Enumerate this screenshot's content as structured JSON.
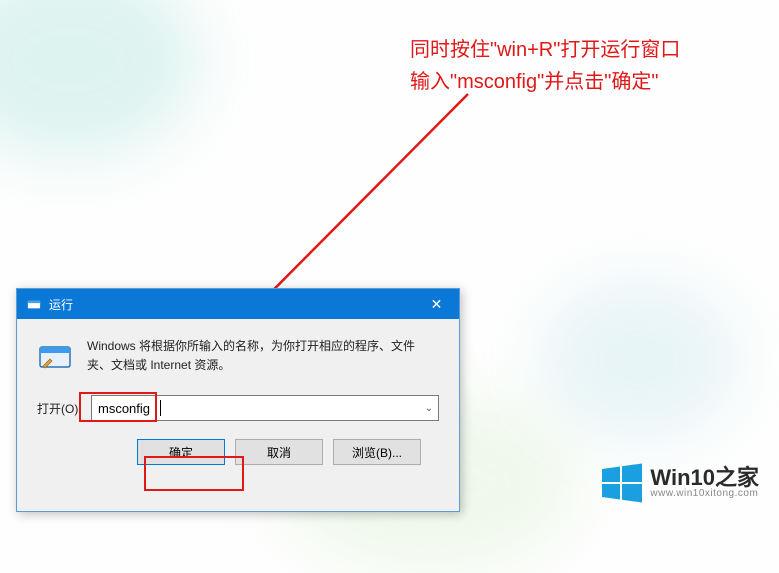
{
  "annotation": {
    "line1": "同时按住\"win+R\"打开运行窗口",
    "line2": "输入\"msconfig\"并点击\"确定\""
  },
  "dialog": {
    "title": "运行",
    "description": "Windows 将根据你所输入的名称，为你打开相应的程序、文件夹、文档或 Internet 资源。",
    "open_label": "打开(O):",
    "input_value": "msconfig",
    "buttons": {
      "ok": "确定",
      "cancel": "取消",
      "browse": "浏览(B)..."
    },
    "close_glyph": "✕"
  },
  "watermark": {
    "brand": "Win10之家",
    "url": "www.win10xitong.com"
  }
}
